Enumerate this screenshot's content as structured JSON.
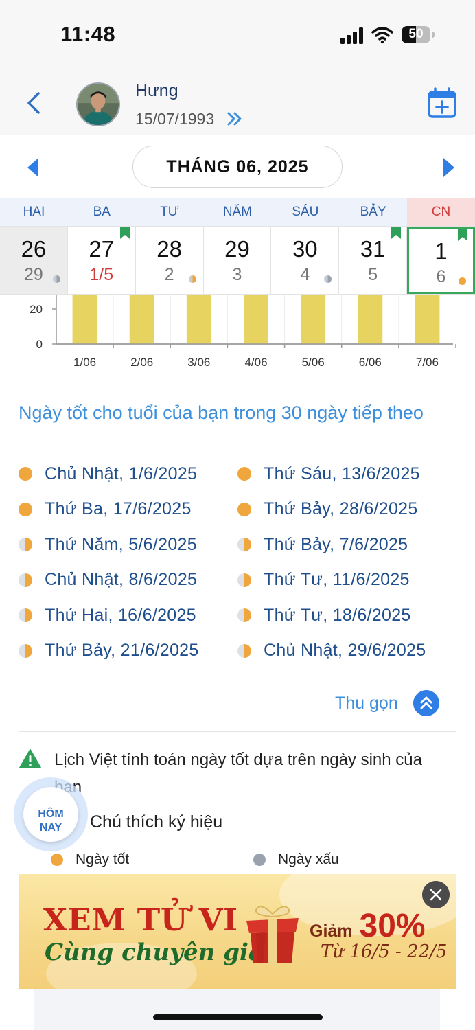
{
  "status_bar": {
    "time": "11:48",
    "battery": "50",
    "battery_level": 0.5
  },
  "header": {
    "user_name": "Hưng",
    "dob": "15/07/1993"
  },
  "calendar": {
    "month_label": "THÁNG 06, 2025",
    "weekdays": [
      "HAI",
      "BA",
      "TƯ",
      "NĂM",
      "SÁU",
      "BẢY",
      "CN"
    ],
    "days": [
      {
        "solar": "26",
        "lunar": "29",
        "lunar_highlight": false,
        "flag": false,
        "dot": "grey",
        "greyed": true,
        "selected": false
      },
      {
        "solar": "27",
        "lunar": "1/5",
        "lunar_highlight": true,
        "flag": true,
        "dot": "none",
        "greyed": false,
        "selected": false
      },
      {
        "solar": "28",
        "lunar": "2",
        "lunar_highlight": false,
        "flag": false,
        "dot": "half",
        "greyed": false,
        "selected": false
      },
      {
        "solar": "29",
        "lunar": "3",
        "lunar_highlight": false,
        "flag": false,
        "dot": "none",
        "greyed": false,
        "selected": false
      },
      {
        "solar": "30",
        "lunar": "4",
        "lunar_highlight": false,
        "flag": false,
        "dot": "grey",
        "greyed": false,
        "selected": false
      },
      {
        "solar": "31",
        "lunar": "5",
        "lunar_highlight": false,
        "flag": true,
        "dot": "none",
        "greyed": false,
        "selected": false
      },
      {
        "solar": "1",
        "lunar": "6",
        "lunar_highlight": false,
        "flag": true,
        "dot": "good",
        "greyed": false,
        "selected": true
      }
    ]
  },
  "chart_data": {
    "type": "bar",
    "categories": [
      "1/06",
      "2/06",
      "3/06",
      "4/06",
      "5/06",
      "6/06",
      "7/06"
    ],
    "yticks": [
      "0",
      "20"
    ],
    "ylim": [
      0,
      28
    ],
    "bar_color": "#e7d35f"
  },
  "good_days": {
    "title": "Ngày tốt cho tuổi của bạn trong 30 ngày tiếp theo",
    "items": [
      {
        "label": "Chủ Nhật, 1/6/2025",
        "type": "good"
      },
      {
        "label": "Thứ Sáu, 13/6/2025",
        "type": "good"
      },
      {
        "label": "Thứ Ba, 17/6/2025",
        "type": "good"
      },
      {
        "label": "Thứ Bảy, 28/6/2025",
        "type": "good"
      },
      {
        "label": "Thứ Năm, 5/6/2025",
        "type": "half"
      },
      {
        "label": "Thứ Bảy, 7/6/2025",
        "type": "half"
      },
      {
        "label": "Chủ Nhật, 8/6/2025",
        "type": "half"
      },
      {
        "label": "Thứ Tư, 11/6/2025",
        "type": "half"
      },
      {
        "label": "Thứ Hai, 16/6/2025",
        "type": "half"
      },
      {
        "label": "Thứ Tư, 18/6/2025",
        "type": "half"
      },
      {
        "label": "Thứ Bảy, 21/6/2025",
        "type": "half"
      },
      {
        "label": "Chủ Nhật, 29/6/2025",
        "type": "half"
      }
    ],
    "collapse_label": "Thu gọn"
  },
  "note": {
    "text": "Lịch Việt  tính toán ngày tốt dựa trên ngày sinh của bạn",
    "legend_title": "Chú thích ký hiệu",
    "legend_good": "Ngày tốt",
    "legend_bad": "Ngày xấu"
  },
  "today_button": {
    "line1": "HÔM",
    "line2": "NAY"
  },
  "banner": {
    "title": "XEM TỬ VI",
    "subtitle": "Cùng chuyên gia",
    "discount_label": "Giảm",
    "discount_value": "30%",
    "period": "Từ 16/5 - 22/5"
  },
  "colors": {
    "accent": "#3d8fdc",
    "good": "#efa63c",
    "bad": "#9aa3ad",
    "sunday": "#d23b3b",
    "selected_border": "#3aa85c",
    "flag": "#2fa05a"
  }
}
